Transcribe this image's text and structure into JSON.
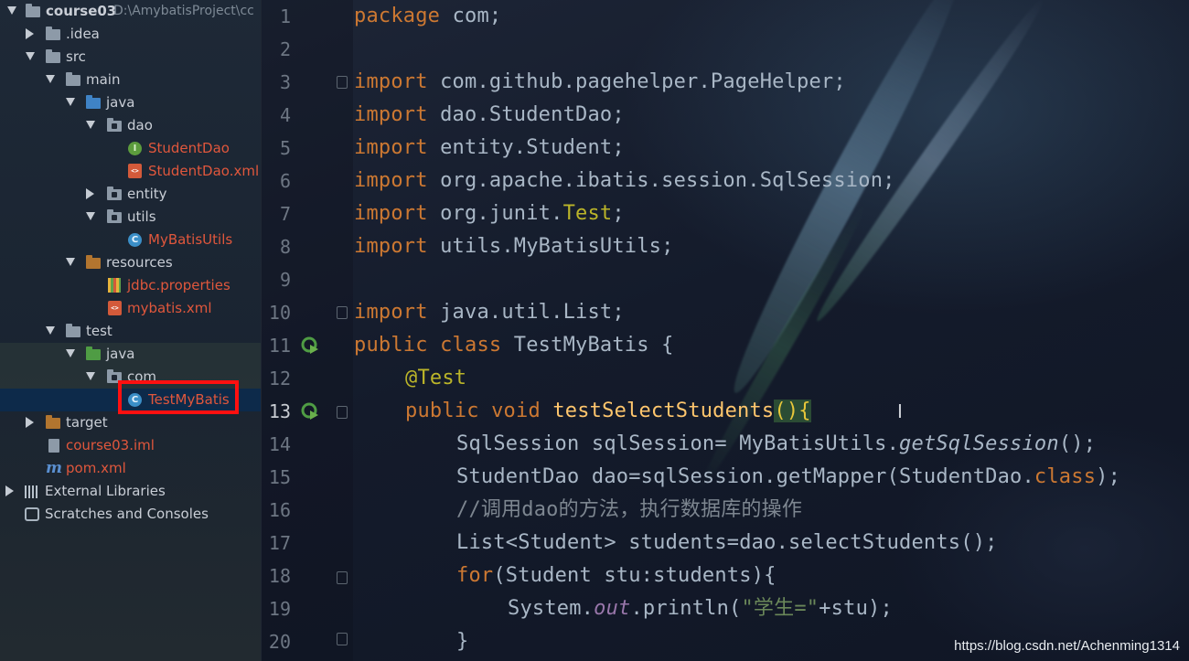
{
  "project": {
    "name": "course03",
    "path": "D:\\AmybatisProject\\cc",
    "tree": [
      {
        "label": "course03"
      },
      {
        "label": ".idea"
      },
      {
        "label": "src"
      },
      {
        "label": "main"
      },
      {
        "label": "java"
      },
      {
        "label": "dao"
      },
      {
        "label": "StudentDao"
      },
      {
        "label": "StudentDao.xml"
      },
      {
        "label": "entity"
      },
      {
        "label": "utils"
      },
      {
        "label": "MyBatisUtils"
      },
      {
        "label": "resources"
      },
      {
        "label": "jdbc.properties"
      },
      {
        "label": "mybatis.xml"
      },
      {
        "label": "test"
      },
      {
        "label": "java"
      },
      {
        "label": "com"
      },
      {
        "label": "TestMyBatis"
      },
      {
        "label": "target"
      },
      {
        "label": "course03.iml"
      },
      {
        "label": "pom.xml"
      },
      {
        "label": "External Libraries"
      },
      {
        "label": "Scratches and Consoles"
      }
    ]
  },
  "icons": {
    "interface": "interface-icon",
    "class": "class-icon",
    "xml": "xml-file-icon",
    "maven": "maven-icon",
    "run": "run-gutter-icon"
  },
  "colors": {
    "keyword": "#cc7832",
    "annotation": "#bbb529",
    "method": "#ffc66d",
    "string": "#6a8759",
    "comment": "#7d8690",
    "selection_box": "#ff1010"
  },
  "editor": {
    "lines": [
      {
        "n": "1"
      },
      {
        "n": "2"
      },
      {
        "n": "3"
      },
      {
        "n": "4"
      },
      {
        "n": "5"
      },
      {
        "n": "6"
      },
      {
        "n": "7"
      },
      {
        "n": "8"
      },
      {
        "n": "9"
      },
      {
        "n": "10"
      },
      {
        "n": "11"
      },
      {
        "n": "12"
      },
      {
        "n": "13"
      },
      {
        "n": "14"
      },
      {
        "n": "15"
      },
      {
        "n": "16"
      },
      {
        "n": "17"
      },
      {
        "n": "18"
      },
      {
        "n": "19"
      },
      {
        "n": "20"
      }
    ],
    "code": {
      "l1_kw": "package",
      "l1_rest": " com;",
      "l3_kw": "import",
      "l3_rest": " com.github.pagehelper.PageHelper;",
      "l4_kw": "import",
      "l4_rest": " dao.StudentDao;",
      "l5_kw": "import",
      "l5_rest": " entity.Student;",
      "l6_kw": "import",
      "l6_rest": " org.apache.ibatis.session.SqlSession;",
      "l7_kw": "import",
      "l7_a": " org.junit.",
      "l7_ann": "Test",
      "l7_b": ";",
      "l8_kw": "import",
      "l8_rest": " utils.MyBatisUtils;",
      "l10_kw": "import",
      "l10_rest": " java.util.List;",
      "l11_kw": "public class",
      "l11_rest": " TestMyBatis {",
      "l12_ann": "@Test",
      "l13_kw": "public void",
      "l13_fn": " testSelectStudents",
      "l13_br1": "()",
      "l13_br2": "{",
      "l14_a": "SqlSession sqlSession= MyBatisUtils.",
      "l14_it": "getSqlSession",
      "l14_b": "();",
      "l15_a": "StudentDao dao=sqlSession.getMapper(StudentDao.",
      "l15_kw": "class",
      "l15_b": ");",
      "l16_cmt": "//调用dao的方法，执行数据库的操作",
      "l17": "List<Student> students=dao.selectStudents();",
      "l18_kw": "for",
      "l18_rest": "(Student stu:students){",
      "l19_a": "System.",
      "l19_fld": "out",
      "l19_b": ".println(",
      "l19_str": "\"学生=\"",
      "l19_c": "+stu);",
      "l20": "}"
    }
  },
  "watermark": "https://blog.csdn.net/Achenming1314"
}
